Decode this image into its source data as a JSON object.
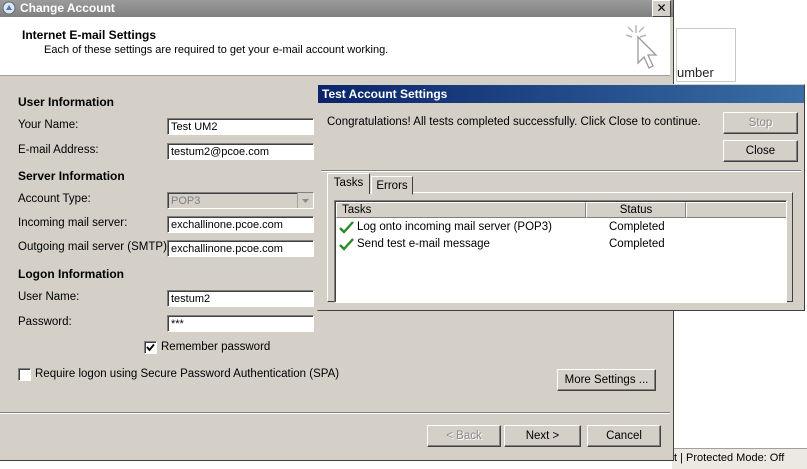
{
  "background": {
    "partial_text": "umber",
    "status_text": "t | Protected Mode: Off"
  },
  "window": {
    "title": "Change Account",
    "close_glyph": "✕"
  },
  "header": {
    "title": "Internet E-mail Settings",
    "subtitle": "Each of these settings are required to get your e-mail account working."
  },
  "form": {
    "user_info_heading": "User Information",
    "your_name_label": "Your Name:",
    "your_name_value": "Test UM2",
    "email_label": "E-mail Address:",
    "email_value": "testum2@pcoe.com",
    "server_info_heading": "Server Information",
    "account_type_label": "Account Type:",
    "account_type_value": "POP3",
    "incoming_label": "Incoming mail server:",
    "incoming_value": "exchallinone.pcoe.com",
    "outgoing_label": "Outgoing mail server (SMTP):",
    "outgoing_value": "exchallinone.pcoe.com",
    "logon_info_heading": "Logon Information",
    "username_label": "User Name:",
    "username_value": "testum2",
    "password_label": "Password:",
    "password_value": "***",
    "remember_label": "Remember password",
    "remember_checked": true,
    "spa_label": "Require logon using Secure Password Authentication (SPA)",
    "spa_checked": false,
    "more_settings": "More Settings ..."
  },
  "footer": {
    "back": "< Back",
    "next": "Next >",
    "cancel": "Cancel"
  },
  "test_dialog": {
    "title": "Test Account Settings",
    "message": "Congratulations! All tests completed successfully. Click Close to continue.",
    "stop": "Stop",
    "close": "Close",
    "tabs": [
      "Tasks",
      "Errors"
    ],
    "columns": [
      "Tasks",
      "Status"
    ],
    "rows": [
      {
        "task": "Log onto incoming mail server (POP3)",
        "status": "Completed",
        "icon": "check-icon"
      },
      {
        "task": "Send test e-mail message",
        "status": "Completed",
        "icon": "check-icon"
      }
    ]
  },
  "colors": {
    "dialog_bg": "#d4d0c8",
    "title_active": "#0a246a",
    "check_green": "#2a8a2a"
  }
}
